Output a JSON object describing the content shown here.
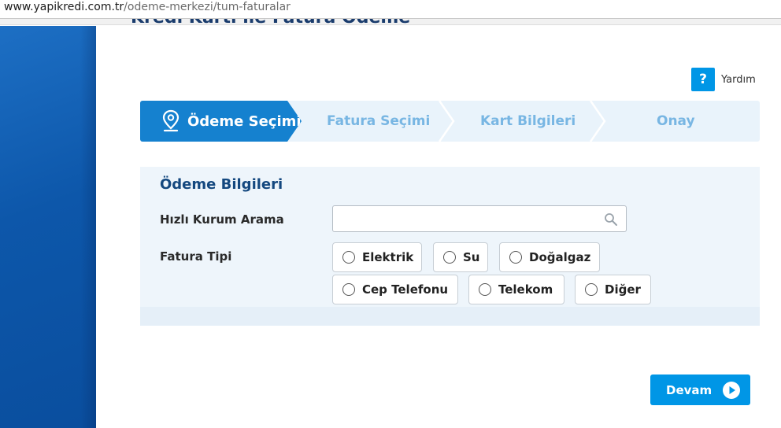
{
  "browser": {
    "url_domain": "www.yapikredi.com.tr",
    "url_path": "/odeme-merkezi/tum-faturalar"
  },
  "page": {
    "cut_title": "Kredi Kartı ile Fatura Ödeme"
  },
  "help": {
    "icon_label": "?",
    "label": "Yardım"
  },
  "steps": [
    {
      "label": "Ödeme Seçimi",
      "active": true
    },
    {
      "label": "Fatura Seçimi",
      "active": false
    },
    {
      "label": "Kart Bilgileri",
      "active": false
    },
    {
      "label": "Onay",
      "active": false
    }
  ],
  "form": {
    "title": "Ödeme Bilgileri",
    "quick_search_label": "Hızlı Kurum Arama",
    "quick_search_value": "",
    "invoice_type_label": "Fatura Tipi",
    "invoice_types": [
      "Elektrik",
      "Su",
      "Doğalgaz",
      "Cep Telefonu",
      "Telekom",
      "Diğer"
    ]
  },
  "actions": {
    "continue_label": "Devam"
  },
  "colors": {
    "accent": "#0096e6",
    "step_active": "#1581cf",
    "step_inactive_text": "#78b6e3",
    "title_dark": "#14487f",
    "sidebar": "#0d57aa"
  }
}
